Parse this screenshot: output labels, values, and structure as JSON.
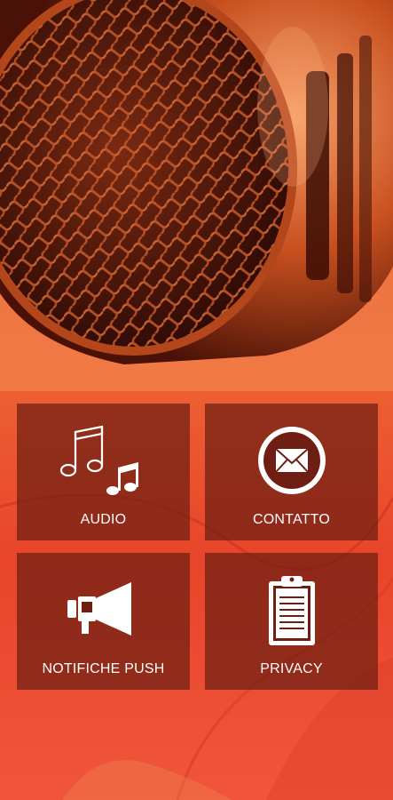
{
  "app": {
    "hero": {
      "icon": "microphone-image"
    },
    "menu": {
      "items": [
        {
          "id": "audio",
          "label": "AUDIO",
          "icon": "music-notes-icon"
        },
        {
          "id": "contatto",
          "label": "CONTATTO",
          "icon": "envelope-icon"
        },
        {
          "id": "push",
          "label": "NOTIFICHE PUSH",
          "icon": "megaphone-icon"
        },
        {
          "id": "privacy",
          "label": "PRIVACY",
          "icon": "clipboard-icon"
        }
      ]
    },
    "colors": {
      "accent": "#ee6a36",
      "tile": "#6e1e12",
      "text": "#ffffff"
    }
  }
}
